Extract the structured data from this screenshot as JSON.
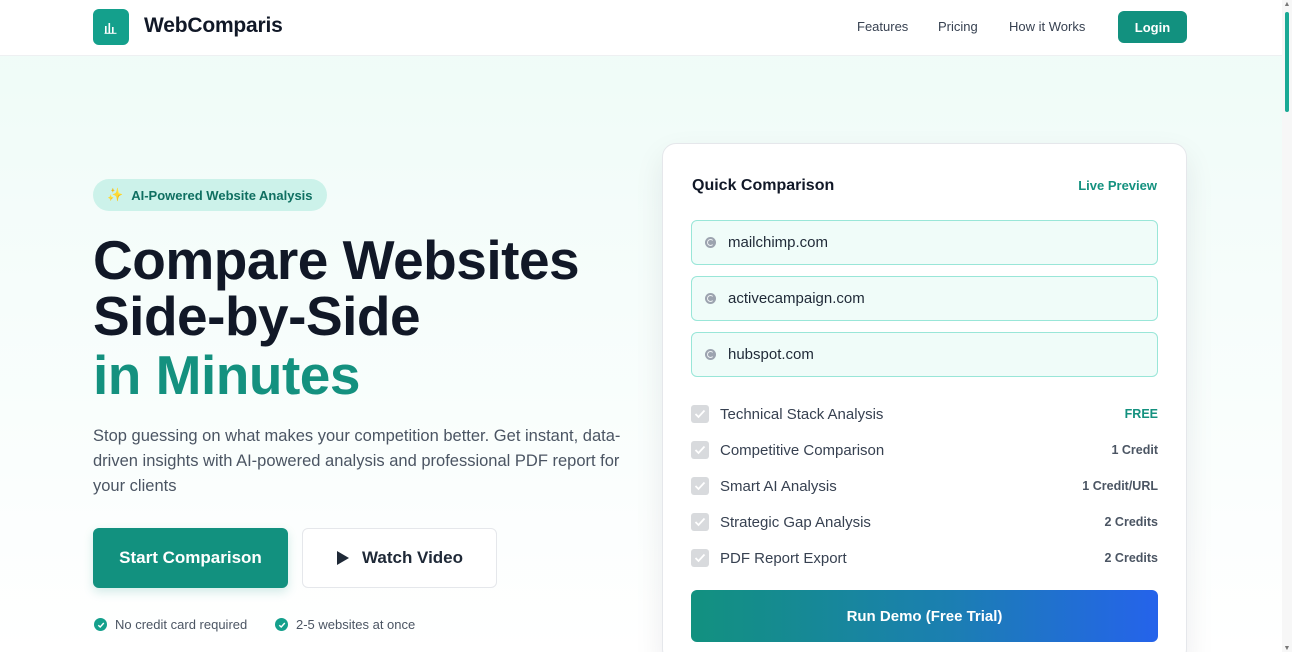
{
  "header": {
    "brand": "WebComparis",
    "nav": [
      "Features",
      "Pricing",
      "How it Works"
    ],
    "login": "Login"
  },
  "hero": {
    "badge": "AI-Powered Website Analysis",
    "title_line1": "Compare Websites",
    "title_line2": "Side-by-Side",
    "title_accent": "in Minutes",
    "lead": "Stop guessing on what makes your competition better. Get instant, data-driven insights with AI-powered analysis and professional PDF report for your clients",
    "primary_cta": "Start Comparison",
    "secondary_cta": "Watch Video",
    "perks": [
      "No credit card required",
      "2-5 websites at once"
    ]
  },
  "card": {
    "title": "Quick Comparison",
    "live": "Live Preview",
    "urls": [
      "mailchimp.com",
      "activecampaign.com",
      "hubspot.com"
    ],
    "options": [
      {
        "label": "Technical Stack Analysis",
        "price": "FREE",
        "checked": true
      },
      {
        "label": "Competitive Comparison",
        "price": "1 Credit",
        "checked": true
      },
      {
        "label": "Smart AI Analysis",
        "price": "1 Credit/URL",
        "checked": true
      },
      {
        "label": "Strategic Gap Analysis",
        "price": "2 Credits",
        "checked": true
      },
      {
        "label": "PDF Report Export",
        "price": "2 Credits",
        "checked": true
      }
    ],
    "run": "Run Demo (Free Trial)"
  },
  "colors": {
    "accent": "#12917f",
    "accent_light": "#ccf2ea",
    "gradient_end": "#2563eb"
  }
}
